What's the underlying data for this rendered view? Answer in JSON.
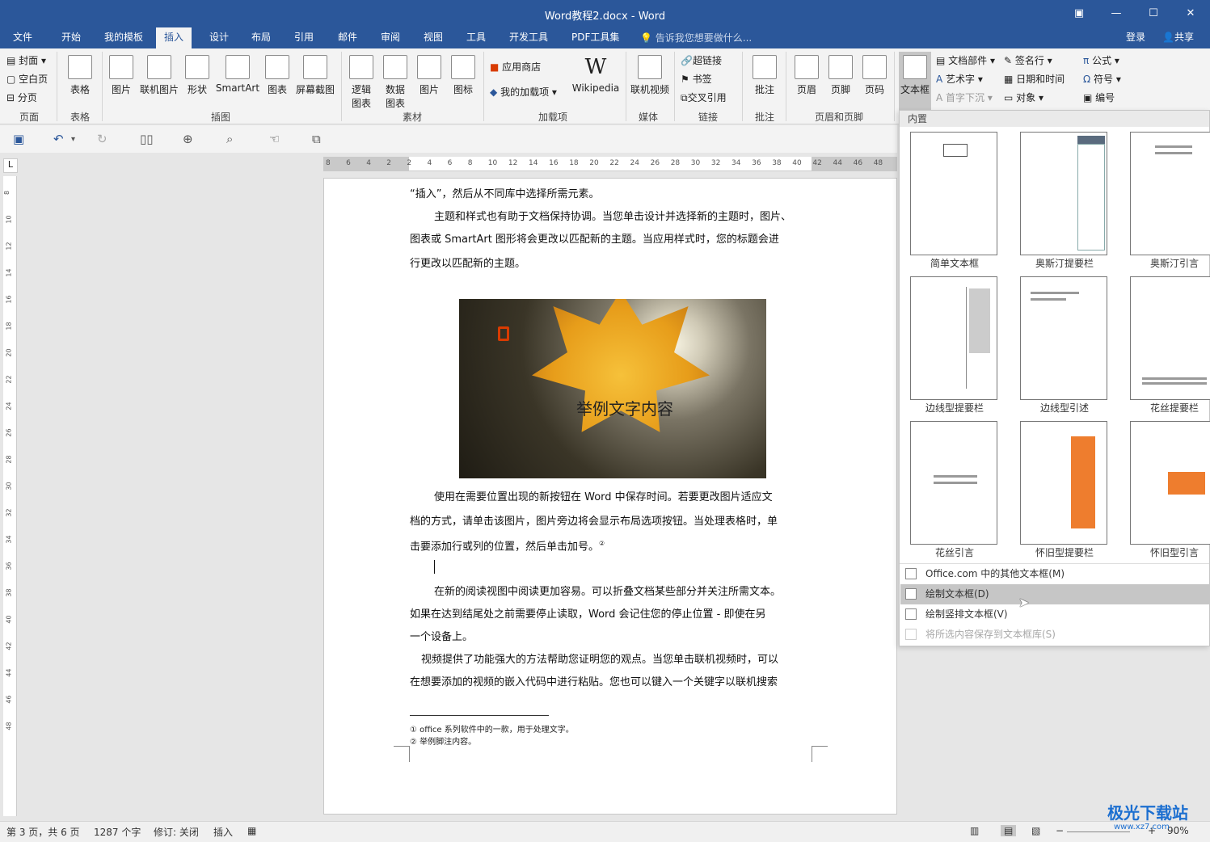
{
  "window": {
    "title": "Word教程2.docx - Word",
    "restore_icon": "restore-icon",
    "minimize_label": "—",
    "maximize_label": "☐",
    "close_label": "✕"
  },
  "menu": {
    "tabs": [
      "文件",
      "开始",
      "我的模板",
      "插入",
      "设计",
      "布局",
      "引用",
      "邮件",
      "审阅",
      "视图",
      "工具",
      "开发工具",
      "PDF工具集"
    ],
    "active_tab": "插入",
    "tellme": "告诉我您想要做什么...",
    "login": "登录",
    "share": "共享"
  },
  "ribbon": {
    "pages": {
      "cover": "封面",
      "blank": "空白页",
      "break": "分页",
      "label": "页面"
    },
    "tables": {
      "table": "表格",
      "label": "表格"
    },
    "illustrations": {
      "picture": "图片",
      "online_picture": "联机图片",
      "shapes": "形状",
      "smartart": "SmartArt",
      "chart": "图表",
      "screenshot": "屏幕截图",
      "label": "插图"
    },
    "material": {
      "logic": "逻辑",
      "logic2": "图表",
      "data": "数据",
      "data2": "图表",
      "picture": "图片",
      "icon": "图标",
      "label": "素材"
    },
    "addins": {
      "store": "应用商店",
      "my_addins": "我的加载项",
      "wikipedia": "Wikipedia",
      "label": "加载项"
    },
    "media": {
      "online_video": "联机视频",
      "label": "媒体"
    },
    "links": {
      "hyperlink": "超链接",
      "bookmark": "书签",
      "crossref": "交叉引用",
      "label": "链接"
    },
    "comments": {
      "comment": "批注",
      "label": "批注"
    },
    "header_footer": {
      "header": "页眉",
      "footer": "页脚",
      "page_number": "页码",
      "label": "页眉和页脚"
    },
    "text": {
      "textbox": "文本框",
      "parts": "文档部件",
      "wordart": "艺术字",
      "dropcap": "首字下沉",
      "signature": "签名行",
      "datetime": "日期和时间",
      "object": "对象"
    },
    "symbols": {
      "equation": "公式",
      "symbol": "符号",
      "number": "编号"
    }
  },
  "ruler": {
    "h_ticks": [
      "8",
      "6",
      "4",
      "2",
      "2",
      "4",
      "6",
      "8",
      "10",
      "12",
      "14",
      "16",
      "18",
      "20",
      "22",
      "24",
      "26",
      "28",
      "30",
      "32",
      "34",
      "36",
      "38",
      "40",
      "42",
      "44",
      "46",
      "48"
    ],
    "v_ticks": [
      "8",
      "10",
      "12",
      "14",
      "16",
      "18",
      "20",
      "22",
      "24",
      "26",
      "28",
      "30",
      "32",
      "34",
      "36",
      "38",
      "40",
      "42",
      "44",
      "46",
      "48"
    ],
    "corner": "L"
  },
  "document": {
    "paragraphs": [
      "“插入”，然后从不同库中选择所需元素。",
      "主题和样式也有助于文档保持协调。当您单击设计并选择新的主题时，图片、",
      "图表或 SmartArt 图形将会更改以匹配新的主题。当应用样式时，您的标题会进",
      "行更改以匹配新的主题。",
      "使用在需要位置出现的新按钮在 Word 中保存时间。若要更改图片适应文",
      "档的方式，请单击该图片，图片旁边将会显示布局选项按钮。当处理表格时，单",
      "击要添加行或列的位置，然后单击加号。",
      "在新的阅读视图中阅读更加容易。可以折叠文档某些部分并关注所需文本。",
      "如果在达到结尾处之前需要停止读取，Word 会记住您的停止位置 - 即使在另",
      "一个设备上。",
      "视频提供了功能强大的方法帮助您证明您的观点。当您单击联机视频时，可以",
      "在想要添加的视频的嵌入代码中进行粘贴。您也可以键入一个关键字以联机搜索"
    ],
    "image_caption": "举例文字内容",
    "footnote_marker": "②",
    "footnotes": [
      "① office 系列软件中的一款，用于处理文字。",
      "② 举例脚注内容。"
    ]
  },
  "panel": {
    "header": "内置",
    "thumbnails": [
      "简单文本框",
      "奥斯汀提要栏",
      "奥斯汀引言",
      "边线型提要栏",
      "边线型引述",
      "花丝提要栏",
      "花丝引言",
      "怀旧型提要栏",
      "怀旧型引言"
    ],
    "menu": [
      {
        "label": "Office.com 中的其他文本框(M)",
        "state": "normal"
      },
      {
        "label": "绘制文本框(D)",
        "state": "highlighted"
      },
      {
        "label": "绘制竖排文本框(V)",
        "state": "normal"
      },
      {
        "label": "将所选内容保存到文本框库(S)",
        "state": "disabled"
      }
    ]
  },
  "status": {
    "page": "第 3 页，共 6 页",
    "words": "1287 个字",
    "track": "修订: 关闭",
    "mode": "插入",
    "zoom": "90%"
  },
  "watermark": {
    "brand": "极光下载站",
    "url": "www.xz7.com"
  },
  "colors": {
    "accent": "#2b579a",
    "orange": "#ee7d2e"
  }
}
